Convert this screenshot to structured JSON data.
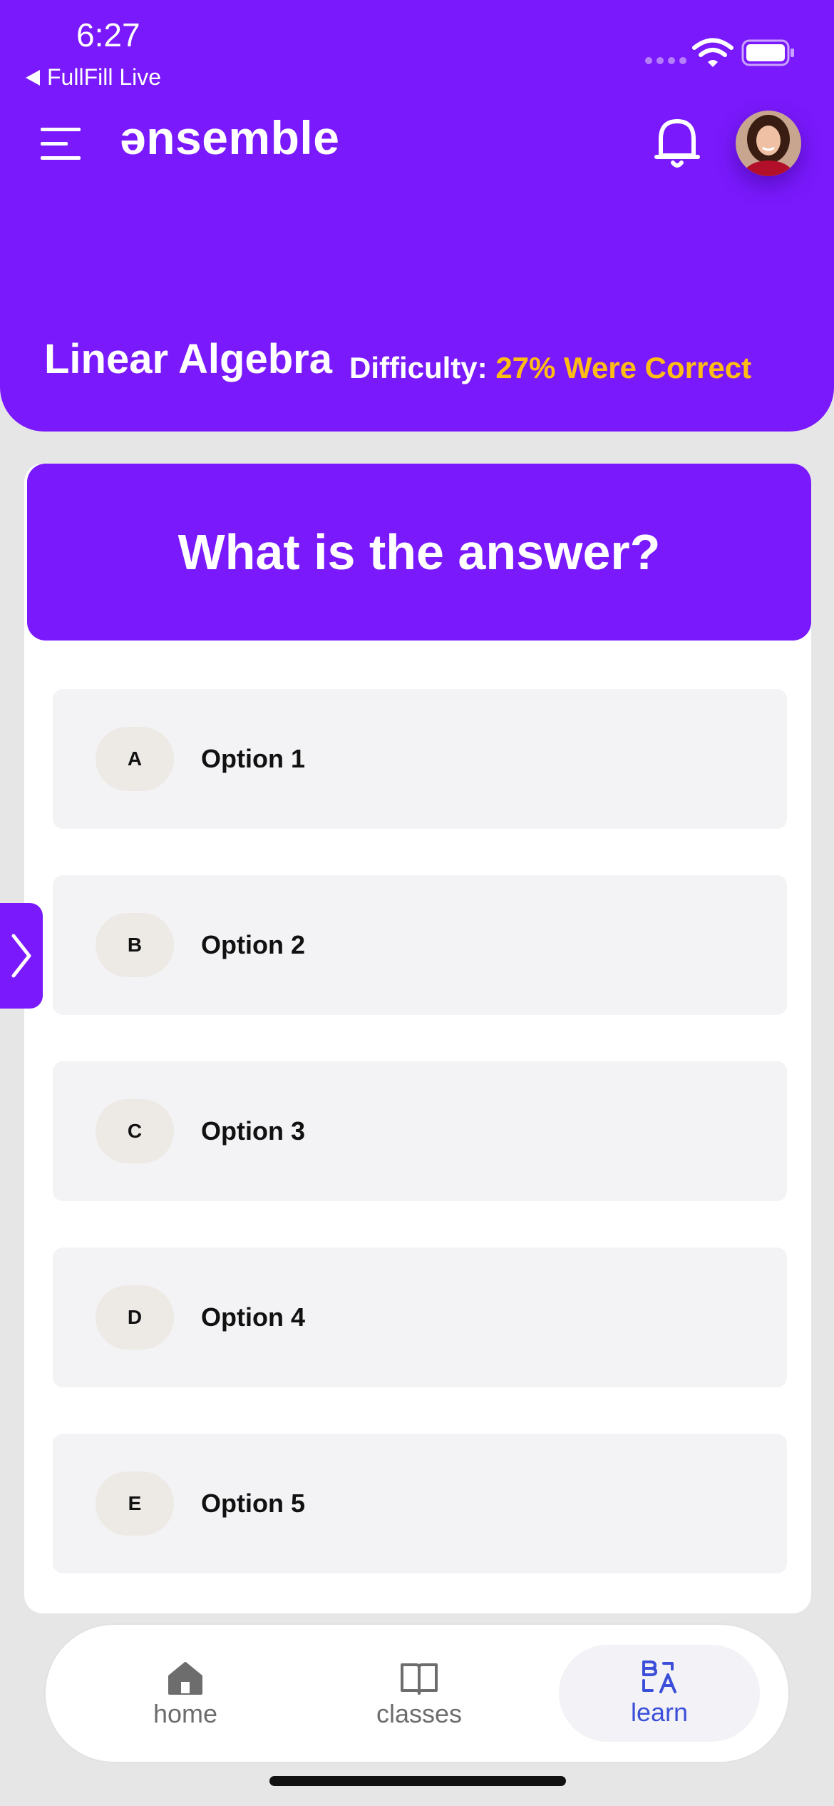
{
  "status_bar": {
    "time": "6:27",
    "back_app": "FullFill Live"
  },
  "header": {
    "logo": "ənsemble",
    "subject": "Linear Algebra",
    "difficulty_label": "Difficulty:",
    "difficulty_value": "27% Were Correct"
  },
  "question": {
    "text": "What is the answer?"
  },
  "options": [
    {
      "letter": "A",
      "label": "Option 1"
    },
    {
      "letter": "B",
      "label": "Option 2"
    },
    {
      "letter": "C",
      "label": "Option 3"
    },
    {
      "letter": "D",
      "label": "Option 4"
    },
    {
      "letter": "E",
      "label": "Option 5"
    }
  ],
  "tabs": [
    {
      "label": "home",
      "icon": "home-icon",
      "active": false
    },
    {
      "label": "classes",
      "icon": "book-icon",
      "active": false
    },
    {
      "label": "learn",
      "icon": "translate-icon",
      "active": true
    }
  ],
  "colors": {
    "brand": "#7a19fc",
    "highlight": "#ffbd14",
    "active_tab": "#3b4fd8"
  }
}
